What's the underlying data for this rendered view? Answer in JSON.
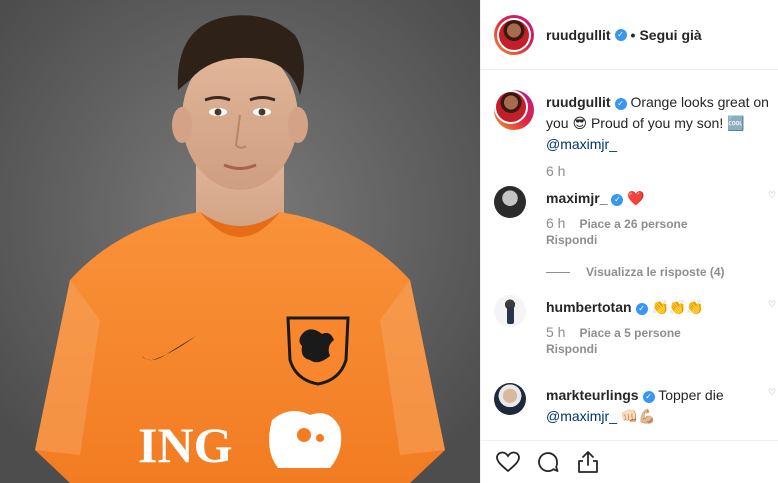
{
  "post": {
    "photo_alt": "Player in orange Netherlands national team shirt"
  },
  "header": {
    "username": "ruudgullit",
    "separator": "•",
    "follow_label": "Segui già"
  },
  "caption": {
    "username": "ruudgullit",
    "text": "Orange looks great on you 😎 Proud of you my son! 🆒",
    "mention": "@maximjr_",
    "time": "6 h"
  },
  "comments": [
    {
      "username": "maximjr_",
      "text": "❤️",
      "time": "6 h",
      "likes": "Piace a 26 persone",
      "reply_label": "Rispondi",
      "view_replies": "Visualizza le risposte (4)"
    },
    {
      "username": "humbertotan",
      "text": "👏👏👏",
      "time": "5 h",
      "likes": "Piace a 5 persone",
      "reply_label": "Rispondi"
    },
    {
      "username": "markteurlings",
      "text": "Topper die",
      "mention": "@maximjr_",
      "emoji_tail": "👊🏻💪🏼"
    }
  ],
  "colors": {
    "verified": "#3897f0",
    "shirt": "#f7862d",
    "background": "#5a5a5a"
  },
  "icons": [
    "heart-icon",
    "comment-icon",
    "share-icon",
    "verified-badge-icon"
  ]
}
